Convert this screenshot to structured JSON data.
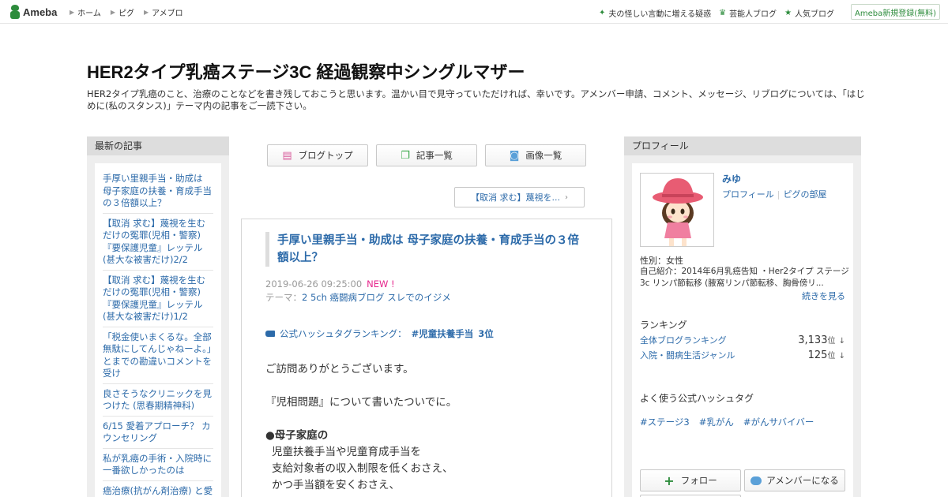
{
  "topbar": {
    "logo_text": "Ameba",
    "nav": [
      "ホーム",
      "ピグ",
      "アメブロ"
    ],
    "links": [
      {
        "icon": "sparkle-icon",
        "label": "夫の怪しい言動に増える疑惑"
      },
      {
        "icon": "crown-icon",
        "label": "芸能人ブログ"
      },
      {
        "icon": "star-icon",
        "label": "人気ブログ"
      }
    ],
    "register_label": "Ameba新規登録(無料)"
  },
  "header": {
    "title": "HER2タイプ乳癌ステージ3C 経過観察中シングルマザー",
    "description": "HER2タイプ乳癌のこと、治療のことなどを書き残しておこうと思います。温かい目で見守っていただければ、幸いです。アメンバー申請、コメント、メッセージ、リブログについては、「はじめに(私のスタンス)」テーマ内の記事をご一読下さい。"
  },
  "sidebar": {
    "heading": "最新の記事",
    "items": [
      "手厚い里親手当・助成は 母子家庭の扶養・育成手当の３倍額以上？",
      "【取消 求む】蔑視を生むだけの冤罪(児相・警察)『要保護児童』レッテル(甚大な被害だけ)2/2",
      "【取消 求む】蔑視を生むだけの冤罪(児相・警察)『要保護児童』レッテル(甚大な被害だけ)1/2",
      "「税金使いまくるな。全部無駄にしてんじゃねーよ。」とまでの勘違いコメントを受け",
      "良さそうなクリニックを見つけた (思春期精神科)",
      "6/15 愛着アプローチ？ カウンセリング",
      "私が乳癌の手術・入院時に一番欲しかったのは",
      "癌治療(抗がん剤治療) と愛着アプローチ の共通点"
    ]
  },
  "main": {
    "nav_buttons": [
      {
        "icon": "list-icon",
        "label": "ブログトップ"
      },
      {
        "icon": "documents-icon",
        "label": "記事一覧"
      },
      {
        "icon": "camera-icon",
        "label": "画像一覧"
      }
    ],
    "prev_label": "【取消 求む】蔑視を...",
    "article": {
      "title": "手厚い里親手当・助成は 母子家庭の扶養・育成手当の３倍額以上？",
      "date": "2019-06-26 09:25:00",
      "new_badge": "NEW !",
      "theme_prefix": "テーマ：",
      "theme": "2 5ch 癌闘病ブログ スレでのイジメ",
      "ranking_prefix": "公式ハッシュタグランキング：",
      "ranking_tag": "#児童扶養手当",
      "ranking_pos": "3位",
      "body": {
        "line1": "ご訪問ありがとうございます。",
        "line2": "『児相問題』について書いたついでに。",
        "line3": "●母子家庭の",
        "line4": "児童扶養手当や児童育成手当を",
        "line5": "支給対象者の収入制限を低くおさえ、",
        "line6": "かつ手当額を安くおさえ、"
      }
    }
  },
  "profile": {
    "heading": "プロフィール",
    "name": "みゆ",
    "link_profile": "プロフィール",
    "link_room": "ピグの部屋",
    "gender": "性別：女性",
    "intro": "自己紹介：2014年6月乳癌告知 ・Her2タイプ ステージ3c リンパ節転移 (腋窩リンパ節転移、胸骨傍リ...",
    "more": "続きを見る",
    "ranking_heading": "ランキング",
    "rankings": [
      {
        "label": "全体ブログランキング",
        "value": "3,133",
        "unit": "位",
        "arrow": "↓"
      },
      {
        "label": "入院・闘病生活ジャンル",
        "value": "125",
        "unit": "位",
        "arrow": "↓"
      }
    ],
    "hashtag_heading": "よく使う公式ハッシュタグ",
    "hashtags": [
      "#ステージ3",
      "#乳がん",
      "#がんサバイバー"
    ],
    "follow_label": "フォロー",
    "amember_label": "アメンバーになる"
  }
}
